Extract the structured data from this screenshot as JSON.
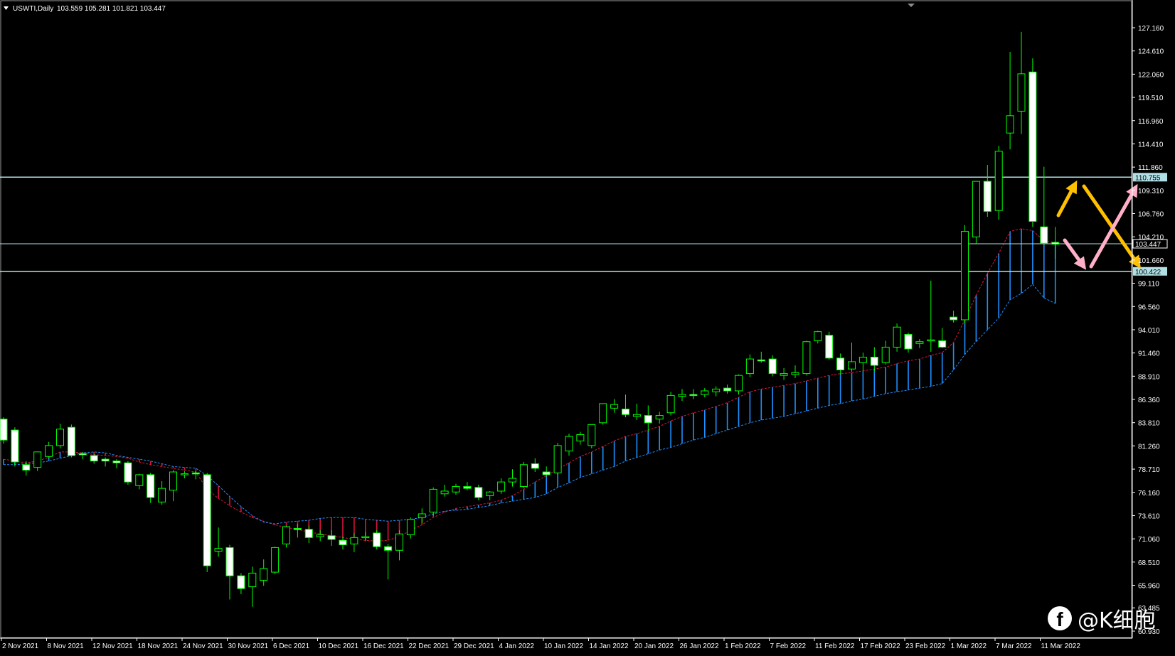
{
  "header": {
    "symbol_label": "USWTI,Daily",
    "ohlc_label": "103.559 105.281 101.821 103.447"
  },
  "watermark": {
    "icon": "facebook-icon",
    "text": "@K细胞"
  },
  "colors": {
    "background": "#000000",
    "bull_candle": "#00ff00",
    "bear_candle": "#ffffff",
    "cloud_bull": "#1e90ff",
    "cloud_bear": "#dc143c",
    "level_line": "#b0e0e6",
    "arrow_yellow": "#ffc000",
    "arrow_pink": "#ffb0c8",
    "axis": "#ffffff"
  },
  "chart_data": {
    "type": "candlestick",
    "ylim": [
      60.93,
      128.5
    ],
    "y_ticks": [
      "127.160",
      "124.610",
      "122.060",
      "119.510",
      "116.960",
      "114.410",
      "111.860",
      "109.310",
      "106.760",
      "104.210",
      "101.660",
      "99.110",
      "96.560",
      "94.010",
      "91.460",
      "88.910",
      "86.360",
      "83.810",
      "81.260",
      "78.710",
      "76.160",
      "73.610",
      "71.060",
      "68.510",
      "65.960",
      "63.485",
      "60.930"
    ],
    "x_labels": [
      "2 Nov 2021",
      "8 Nov 2021",
      "12 Nov 2021",
      "18 Nov 2021",
      "24 Nov 2021",
      "30 Nov 2021",
      "6 Dec 2021",
      "10 Dec 2021",
      "16 Dec 2021",
      "22 Dec 2021",
      "29 Dec 2021",
      "4 Jan 2022",
      "10 Jan 2022",
      "14 Jan 2022",
      "20 Jan 2022",
      "26 Jan 2022",
      "1 Feb 2022",
      "7 Feb 2022",
      "11 Feb 2022",
      "17 Feb 2022",
      "23 Feb 2022",
      "1 Mar 2022",
      "7 Mar 2022",
      "11 Mar 2022"
    ],
    "levels": [
      {
        "value": 110.755,
        "label": "110.755"
      },
      {
        "value": 103.447,
        "label": "103.447"
      },
      {
        "value": 100.422,
        "label": "100.422"
      }
    ],
    "candles": [
      [
        84.2,
        84.4,
        81.5,
        81.9
      ],
      [
        83.0,
        83.3,
        79.0,
        79.5
      ],
      [
        79.2,
        79.6,
        78.0,
        78.6
      ],
      [
        78.9,
        80.4,
        78.5,
        80.6
      ],
      [
        80.1,
        81.7,
        79.9,
        81.3
      ],
      [
        81.3,
        83.7,
        81.0,
        83.1
      ],
      [
        83.3,
        83.6,
        80.0,
        80.2
      ],
      [
        80.4,
        80.6,
        79.8,
        80.3
      ],
      [
        80.2,
        80.4,
        79.3,
        79.6
      ],
      [
        79.8,
        80.0,
        79.0,
        79.6
      ],
      [
        79.6,
        79.8,
        78.8,
        79.4
      ],
      [
        79.4,
        79.6,
        77.0,
        77.3
      ],
      [
        76.9,
        78.2,
        76.5,
        78.1
      ],
      [
        78.1,
        78.3,
        75.0,
        75.6
      ],
      [
        75.1,
        77.4,
        74.8,
        76.6
      ],
      [
        76.4,
        78.6,
        75.2,
        78.4
      ],
      [
        78.1,
        78.5,
        77.7,
        78.2
      ],
      [
        78.3,
        78.5,
        77.6,
        78.2
      ],
      [
        78.1,
        78.3,
        67.4,
        68.1
      ],
      [
        69.7,
        72.3,
        69.1,
        70.0
      ],
      [
        70.1,
        70.4,
        64.4,
        67.0
      ],
      [
        67.0,
        67.3,
        65.0,
        65.6
      ],
      [
        65.8,
        68.0,
        63.6,
        67.3
      ],
      [
        66.5,
        68.8,
        65.9,
        67.8
      ],
      [
        67.4,
        70.2,
        67.2,
        70.1
      ],
      [
        70.5,
        72.5,
        70.1,
        72.4
      ],
      [
        72.2,
        72.7,
        71.2,
        72.1
      ],
      [
        72.1,
        72.5,
        70.6,
        71.2
      ],
      [
        71.3,
        72.0,
        70.8,
        71.5
      ],
      [
        71.4,
        72.0,
        70.3,
        71.0
      ],
      [
        70.9,
        71.3,
        69.9,
        70.4
      ],
      [
        70.5,
        71.7,
        69.6,
        71.2
      ],
      [
        71.3,
        71.8,
        70.8,
        71.3
      ],
      [
        71.7,
        72.0,
        69.9,
        70.2
      ],
      [
        70.2,
        70.5,
        66.6,
        69.8
      ],
      [
        69.8,
        72.0,
        68.7,
        71.6
      ],
      [
        71.5,
        73.4,
        71.1,
        73.2
      ],
      [
        73.4,
        74.4,
        72.8,
        73.8
      ],
      [
        74.0,
        76.7,
        73.6,
        76.5
      ],
      [
        76.0,
        77.0,
        75.7,
        76.3
      ],
      [
        76.2,
        77.1,
        75.9,
        76.8
      ],
      [
        76.8,
        77.3,
        76.4,
        76.6
      ],
      [
        76.7,
        77.0,
        75.3,
        75.6
      ],
      [
        75.8,
        76.3,
        75.3,
        76.2
      ],
      [
        76.3,
        77.7,
        76.0,
        77.3
      ],
      [
        77.3,
        78.7,
        76.8,
        77.7
      ],
      [
        76.8,
        79.5,
        76.6,
        79.2
      ],
      [
        79.3,
        79.9,
        78.4,
        78.8
      ],
      [
        78.4,
        79.0,
        77.9,
        78.1
      ],
      [
        78.3,
        81.6,
        78.1,
        81.3
      ],
      [
        80.7,
        82.6,
        80.2,
        82.3
      ],
      [
        81.8,
        82.8,
        81.4,
        82.5
      ],
      [
        81.3,
        83.6,
        81.0,
        83.6
      ],
      [
        83.8,
        85.9,
        83.6,
        85.9
      ],
      [
        85.4,
        86.4,
        84.9,
        85.8
      ],
      [
        85.3,
        86.9,
        84.4,
        84.7
      ],
      [
        84.5,
        85.9,
        84.1,
        84.7
      ],
      [
        84.6,
        85.7,
        82.8,
        83.8
      ],
      [
        84.2,
        85.0,
        83.7,
        84.6
      ],
      [
        84.9,
        87.2,
        84.6,
        86.8
      ],
      [
        86.7,
        87.5,
        86.2,
        86.9
      ],
      [
        86.9,
        87.5,
        86.4,
        86.8
      ],
      [
        86.9,
        87.6,
        86.6,
        87.3
      ],
      [
        87.2,
        87.8,
        86.7,
        87.5
      ],
      [
        87.6,
        88.0,
        87.0,
        87.3
      ],
      [
        87.3,
        89.1,
        86.9,
        89.0
      ],
      [
        89.2,
        91.3,
        88.8,
        90.8
      ],
      [
        90.7,
        91.6,
        90.4,
        90.6
      ],
      [
        90.8,
        91.2,
        88.9,
        89.2
      ],
      [
        89.0,
        89.8,
        88.5,
        89.2
      ],
      [
        89.1,
        90.1,
        88.7,
        89.3
      ],
      [
        89.2,
        92.8,
        89.0,
        92.7
      ],
      [
        92.8,
        93.9,
        92.5,
        93.8
      ],
      [
        93.4,
        93.8,
        90.7,
        90.9
      ],
      [
        90.9,
        91.4,
        89.1,
        89.6
      ],
      [
        89.7,
        92.6,
        89.4,
        90.5
      ],
      [
        90.4,
        91.5,
        89.5,
        91.0
      ],
      [
        91.0,
        92.1,
        89.5,
        90.1
      ],
      [
        90.4,
        92.8,
        90.2,
        92.1
      ],
      [
        92.1,
        94.7,
        91.6,
        94.3
      ],
      [
        93.5,
        93.7,
        91.5,
        91.9
      ],
      [
        92.5,
        93.0,
        92.0,
        92.7
      ],
      [
        92.8,
        99.4,
        91.6,
        92.9
      ],
      [
        92.8,
        94.2,
        92.0,
        92.1
      ],
      [
        95.4,
        96.1,
        94.8,
        95.1
      ],
      [
        95.1,
        105.5,
        94.7,
        104.8
      ],
      [
        104.2,
        108.0,
        103.5,
        110.3
      ],
      [
        110.3,
        112.1,
        106.4,
        107.0
      ],
      [
        107.1,
        114.2,
        106.1,
        113.6
      ],
      [
        115.6,
        124.5,
        113.8,
        117.5
      ],
      [
        118.0,
        126.7,
        115.5,
        122.1
      ],
      [
        122.3,
        123.8,
        105.3,
        105.9
      ],
      [
        105.3,
        111.9,
        103.3,
        103.5
      ],
      [
        103.6,
        105.3,
        101.8,
        103.4
      ]
    ],
    "cloud_top": [
      79.8,
      79.6,
      79.4,
      79.6,
      80.0,
      80.6,
      80.6,
      80.5,
      80.3,
      80.2,
      80.1,
      79.9,
      79.5,
      79.2,
      79.0,
      78.8,
      78.6,
      78.4,
      76.5,
      75.5,
      74.7,
      74.0,
      73.4,
      73.0,
      72.6,
      72.3,
      72.1,
      71.8,
      71.6,
      71.4,
      71.2,
      71.0,
      70.9,
      70.8,
      70.9,
      71.3,
      72.0,
      72.6,
      73.4,
      74.0,
      74.4,
      74.6,
      74.8,
      75.0,
      75.3,
      75.8,
      76.5,
      77.3,
      78.0,
      78.7,
      79.4,
      80.1,
      80.6,
      81.2,
      81.8,
      82.3,
      82.6,
      83.0,
      83.4,
      84.0,
      84.5,
      84.9,
      85.2,
      85.6,
      86.0,
      86.6,
      87.2,
      87.5,
      87.7,
      87.9,
      88.1,
      88.4,
      88.7,
      89.0,
      89.2,
      89.3,
      89.5,
      89.7,
      89.9,
      90.3,
      90.6,
      90.8,
      91.2,
      91.5,
      92.6,
      95.1,
      97.8,
      100.2,
      102.4,
      104.8,
      105.1,
      104.9,
      103.8,
      103.5
    ],
    "cloud_bottom": [
      79.2,
      79.2,
      79.3,
      79.4,
      79.6,
      79.9,
      80.2,
      80.5,
      80.6,
      80.5,
      80.2,
      80.0,
      79.8,
      79.6,
      79.3,
      79.0,
      78.9,
      78.8,
      78.0,
      76.9,
      75.7,
      74.6,
      73.6,
      72.9,
      72.7,
      72.9,
      73.0,
      73.1,
      73.3,
      73.4,
      73.4,
      73.4,
      73.2,
      73.1,
      73.0,
      73.1,
      73.2,
      73.4,
      73.8,
      74.1,
      74.2,
      74.3,
      74.5,
      74.7,
      75.0,
      75.2,
      75.4,
      75.6,
      76.0,
      76.7,
      77.2,
      77.8,
      78.2,
      78.6,
      79.0,
      79.6,
      80.0,
      80.4,
      80.8,
      81.1,
      81.5,
      81.9,
      82.2,
      82.6,
      83.0,
      83.4,
      83.8,
      84.1,
      84.3,
      84.5,
      84.8,
      85.1,
      85.4,
      85.7,
      85.9,
      86.2,
      86.4,
      86.7,
      87.0,
      87.2,
      87.4,
      87.6,
      87.8,
      88.1,
      89.6,
      91.3,
      92.7,
      94.0,
      95.3,
      97.3,
      98.0,
      99.0,
      97.5,
      96.9
    ]
  }
}
